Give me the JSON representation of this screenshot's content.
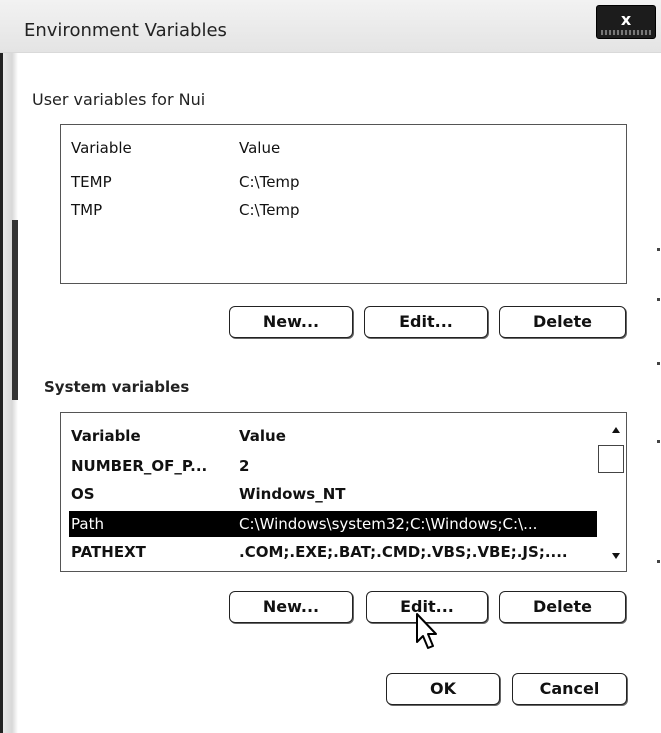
{
  "window": {
    "title": "Environment Variables",
    "close_symbol": "x"
  },
  "user_group": {
    "label": "User variables for Nui",
    "columns": [
      "Variable",
      "Value"
    ],
    "rows": [
      {
        "variable": "TEMP",
        "value": "C:\\Temp"
      },
      {
        "variable": "TMP",
        "value": "C:\\Temp"
      }
    ],
    "buttons": {
      "new": "New...",
      "edit": "Edit...",
      "delete": "Delete"
    }
  },
  "system_group": {
    "label": "System variables",
    "columns": [
      "Variable",
      "Value"
    ],
    "rows": [
      {
        "variable": "NUMBER_OF_P...",
        "value": "2"
      },
      {
        "variable": "OS",
        "value": "Windows_NT"
      },
      {
        "variable": "Path",
        "value": "C:\\Windows\\system32;C:\\Windows;C:\\..."
      },
      {
        "variable": "PATHEXT",
        "value": ".COM;.EXE;.BAT;.CMD;.VBS;.VBE;.JS;...."
      }
    ],
    "selected_row": "Path",
    "buttons": {
      "new": "New...",
      "edit": "Edit...",
      "delete": "Delete"
    }
  },
  "footer": {
    "ok": "OK",
    "cancel": "Cancel"
  },
  "icons": {
    "close": "close-icon",
    "cursor": "mouse-pointer-icon",
    "scroll_up": "scroll-up-arrow-icon",
    "scroll_down": "scroll-down-arrow-icon"
  }
}
